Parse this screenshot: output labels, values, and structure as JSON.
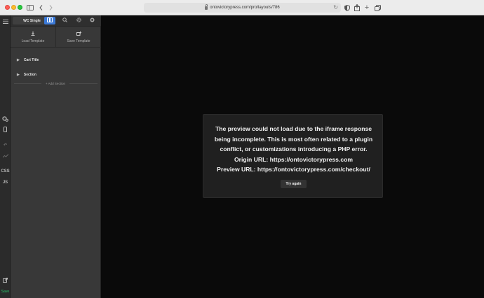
{
  "browser": {
    "url": "ontovictorypress.com/pro/layouts/786"
  },
  "panel": {
    "document_title": "WC Single",
    "load_template_label": "Load Template",
    "save_template_label": "Save Template",
    "structure": [
      {
        "label": "Cart Title"
      },
      {
        "label": "Section"
      }
    ],
    "add_section_label": "+ Add Section"
  },
  "rail": {
    "css_label": "CSS",
    "js_label": "JS",
    "save_label": "Save"
  },
  "error": {
    "lines": [
      "The preview could not load due to the iframe response",
      "being incomplete. This is most often related to a plugin",
      "conflict, or customizations introducing a PHP error.",
      "Origin URL: https://ontovictorypress.com",
      "Preview URL: https://ontovictorypress.com/checkout/"
    ],
    "button_label": "Try again"
  },
  "colors": {
    "accent": "#3b7ad8",
    "save": "#2ec26b",
    "canvas": "#0a0a0a",
    "modal": "#202020"
  }
}
